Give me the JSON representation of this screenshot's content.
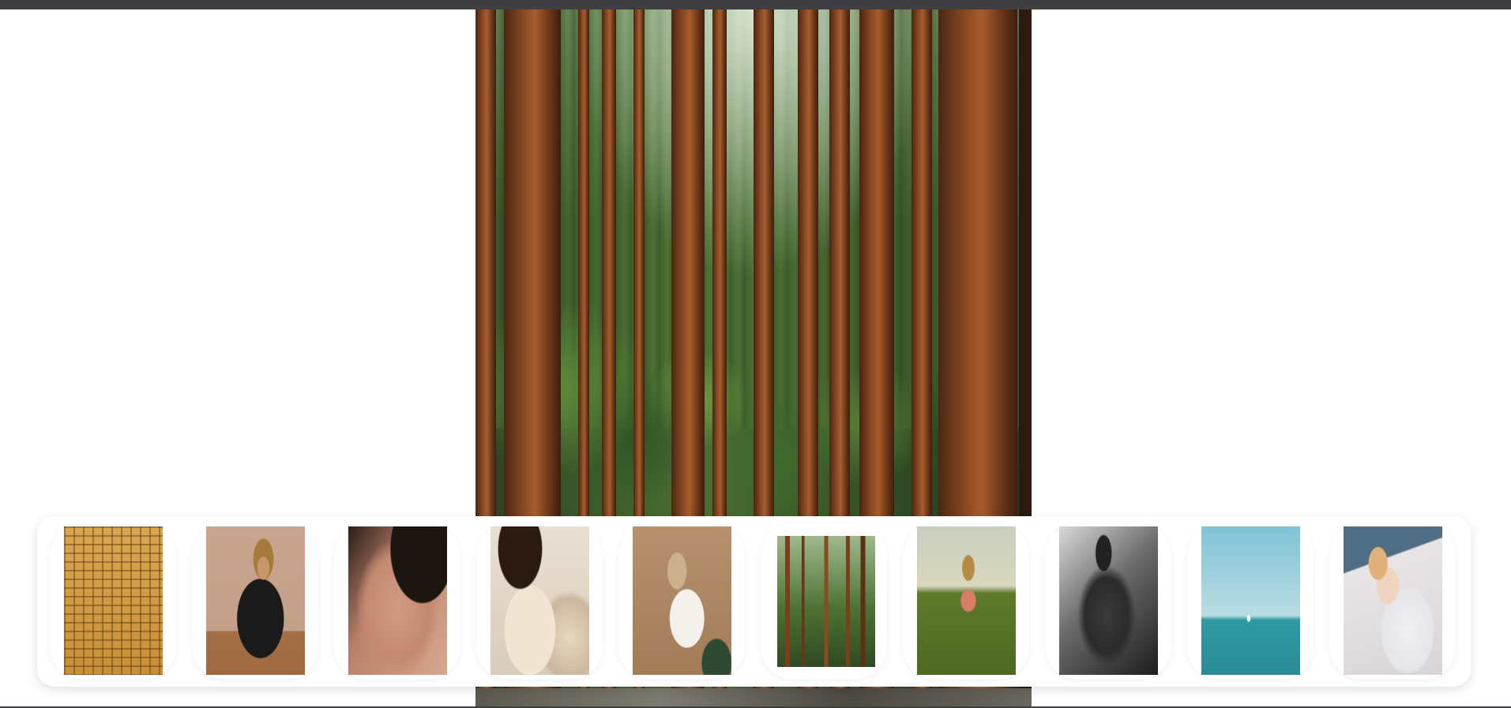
{
  "viewer": {
    "main_image": {
      "icon": "forest-photo",
      "alt": "forest"
    },
    "thumbnails": [
      {
        "icon": "building-facade-photo",
        "selected": false
      },
      {
        "icon": "woman-sitting-photo",
        "selected": false
      },
      {
        "icon": "face-closeup-photo",
        "selected": false
      },
      {
        "icon": "woman-braid-photo",
        "selected": false
      },
      {
        "icon": "woman-chair-photo",
        "selected": false
      },
      {
        "icon": "forest-photo",
        "selected": true
      },
      {
        "icon": "woman-field-photo",
        "selected": false
      },
      {
        "icon": "bw-portrait-photo",
        "selected": false
      },
      {
        "icon": "sea-sailboat-photo",
        "selected": false
      },
      {
        "icon": "baby-photo",
        "selected": false
      }
    ]
  },
  "colors": {
    "top_bar": "#3f3f41",
    "background": "#ffffff",
    "strip": "#ffffff"
  }
}
